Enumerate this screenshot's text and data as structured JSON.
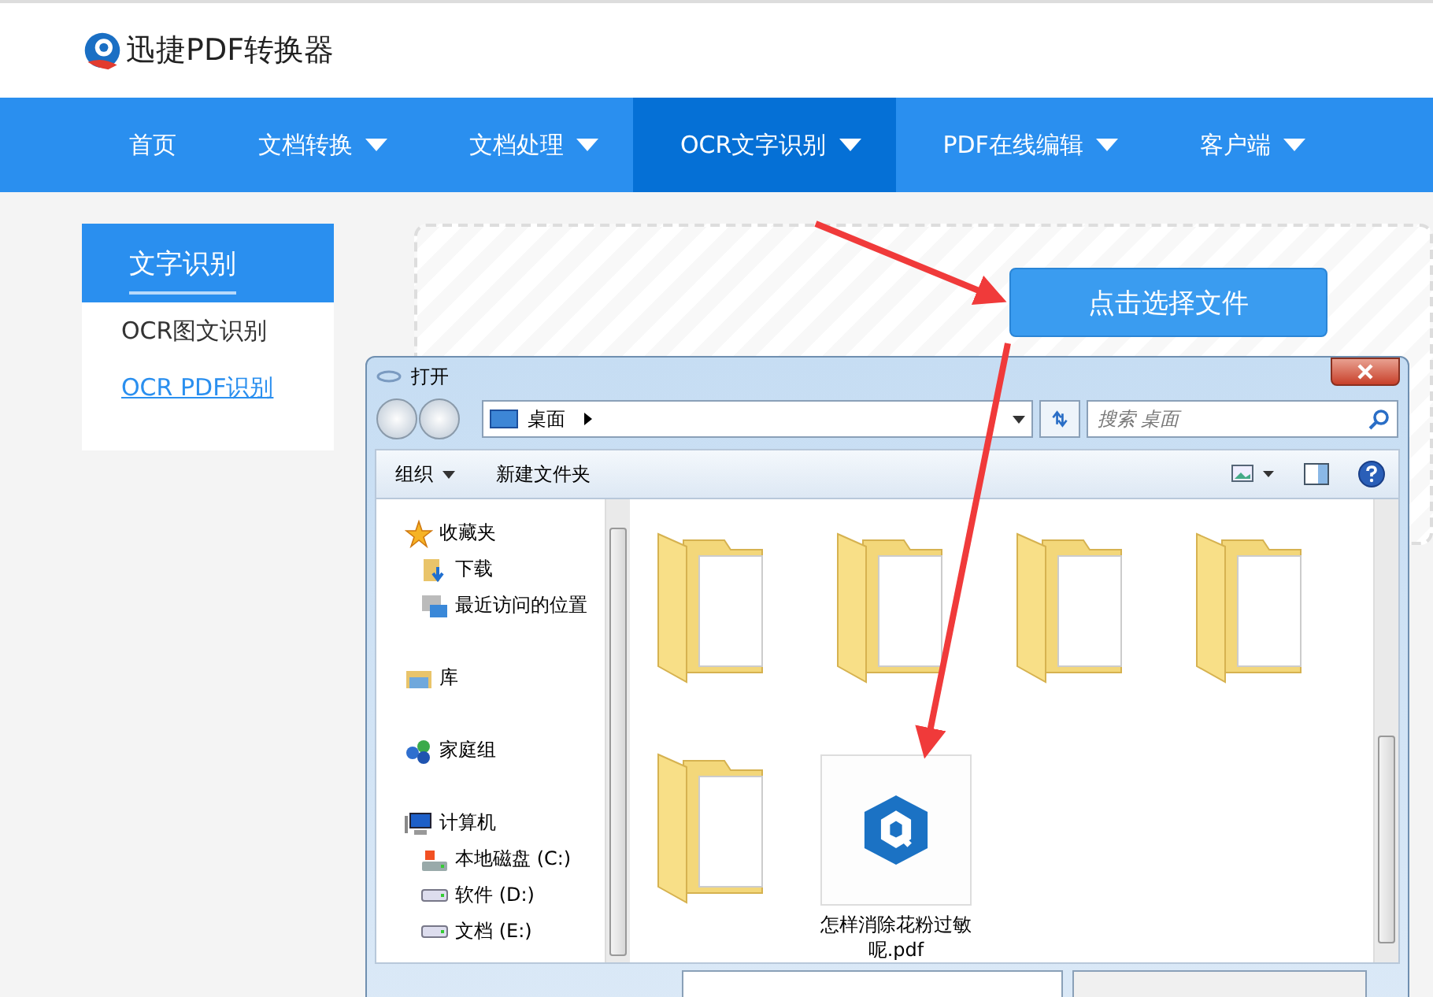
{
  "site": {
    "logo_text": "迅捷PDF转换器"
  },
  "nav": [
    {
      "label": "首页",
      "dropdown": false,
      "selected": false
    },
    {
      "label": "文档转换",
      "dropdown": true,
      "selected": false
    },
    {
      "label": "文档处理",
      "dropdown": true,
      "selected": false
    },
    {
      "label": "OCR文字识别",
      "dropdown": true,
      "selected": true
    },
    {
      "label": "PDF在线编辑",
      "dropdown": true,
      "selected": false
    },
    {
      "label": "客户端",
      "dropdown": true,
      "selected": false
    }
  ],
  "sidebar": {
    "title": "文字识别",
    "items": [
      {
        "label": "OCR图文识别",
        "selected": false
      },
      {
        "label": "OCR PDF识别",
        "selected": true
      }
    ]
  },
  "upload_button": "点击选择文件",
  "dialog": {
    "title": "打开",
    "address": "桌面",
    "search_placeholder": "搜索 桌面",
    "toolbar": [
      {
        "label": "组织",
        "dropdown": true
      },
      {
        "label": "新建文件夹",
        "dropdown": false
      }
    ],
    "nav_tree": [
      {
        "label": "收藏夹",
        "kind": "star",
        "children": [
          {
            "label": "下载",
            "kind": "download"
          },
          {
            "label": "最近访问的位置",
            "kind": "recent"
          }
        ]
      },
      {
        "label": "库",
        "kind": "library"
      },
      {
        "label": "家庭组",
        "kind": "homegroup"
      },
      {
        "label": "计算机",
        "kind": "computer",
        "children": [
          {
            "label": "本地磁盘 (C:)",
            "kind": "system-drive"
          },
          {
            "label": "软件 (D:)",
            "kind": "drive"
          },
          {
            "label": "文档 (E:)",
            "kind": "drive"
          }
        ]
      }
    ],
    "files": [
      {
        "kind": "folder"
      },
      {
        "kind": "folder"
      },
      {
        "kind": "folder"
      },
      {
        "kind": "folder"
      },
      {
        "kind": "folder"
      },
      {
        "kind": "pdf",
        "name": "怎样消除花粉过敏呢.pdf"
      }
    ]
  }
}
